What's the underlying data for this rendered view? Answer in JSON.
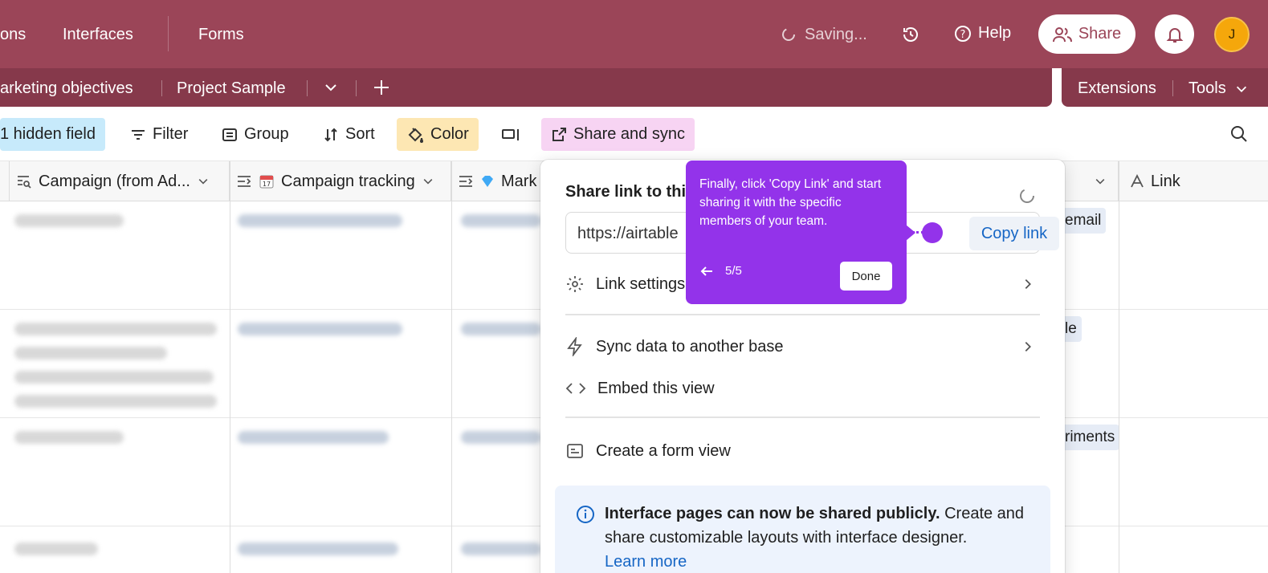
{
  "topbar": {
    "nav_partial": "ons",
    "interfaces": "Interfaces",
    "forms": "Forms",
    "saving": "Saving...",
    "help": "Help",
    "share": "Share",
    "avatar_initial": "J"
  },
  "tablebar": {
    "tab1": "arketing objectives",
    "tab2": "Project Sample",
    "extensions": "Extensions",
    "tools": "Tools"
  },
  "toolbar": {
    "hidden_field": "1 hidden field",
    "filter": "Filter",
    "group": "Group",
    "sort": "Sort",
    "color": "Color",
    "share_sync": "Share and sync"
  },
  "columns": {
    "campaign_from": "Campaign (from Ad...",
    "campaign_tracking": "Campaign tracking",
    "marketing_partial": "Mark",
    "link": "Link"
  },
  "chips": [
    "email",
    "le",
    "riments"
  ],
  "popover": {
    "title": "Share link to this view",
    "url": "https://airtable",
    "copy_link": "Copy link",
    "link_settings": "Link settings",
    "sync": "Sync data to another base",
    "embed": "Embed this view",
    "form_view": "Create a form view",
    "info_bold": "Interface pages can now be shared publicly.",
    "info_rest": " Create and share customizable layouts with interface designer.",
    "learn_more": "Learn more"
  },
  "tooltip": {
    "text": "Finally, click 'Copy Link' and start sharing it with the specific members of your team.",
    "step": "5/5",
    "done": "Done"
  },
  "colors": {
    "topbar": "#9b4558",
    "tablebar": "#86394b",
    "tooltip": "#9333ea",
    "link": "#1666c5"
  }
}
